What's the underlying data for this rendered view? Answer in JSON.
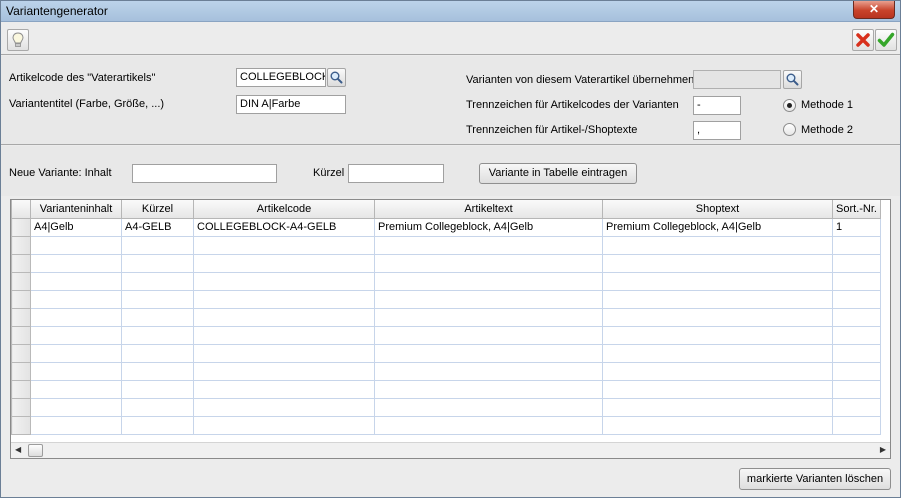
{
  "window": {
    "title": "Variantengenerator",
    "close_label": "✕"
  },
  "toolbar": {
    "hint_icon": "lightbulb-icon",
    "cancel_icon": "red-x-icon",
    "ok_icon": "green-check-icon"
  },
  "form": {
    "parent_code_label": "Artikelcode des \"Vaterartikels\"",
    "parent_code_value": "COLLEGEBLOCK",
    "variant_title_label": "Variantentitel (Farbe, Größe, ...)",
    "variant_title_value": "DIN A|Farbe",
    "copy_variants_label": "Varianten von diesem Vaterartikel übernehmen",
    "copy_variants_value": "",
    "separator_codes_label": "Trennzeichen für Artikelcodes der Varianten",
    "separator_codes_value": "-",
    "separator_text_label": "Trennzeichen für Artikel-/Shoptexte",
    "separator_text_value": ",",
    "method1_label": "Methode 1",
    "method2_label": "Methode 2",
    "selected_method": "Methode 1"
  },
  "new_variant": {
    "content_label": "Neue Variante: Inhalt",
    "content_value": "",
    "short_label": "Kürzel",
    "short_value": "",
    "add_button": "Variante in Tabelle eintragen"
  },
  "table": {
    "columns": [
      "Varianteninhalt",
      "Kürzel",
      "Artikelcode",
      "Artikeltext",
      "Shoptext",
      "Sort.-Nr."
    ],
    "rows": [
      [
        "A4|Gelb",
        "A4-GELB",
        "COLLEGEBLOCK-A4-GELB",
        "Premium Collegeblock, A4|Gelb",
        "Premium Collegeblock, A4|Gelb",
        "1"
      ]
    ]
  },
  "footer": {
    "delete_button": "markierte Varianten löschen"
  }
}
